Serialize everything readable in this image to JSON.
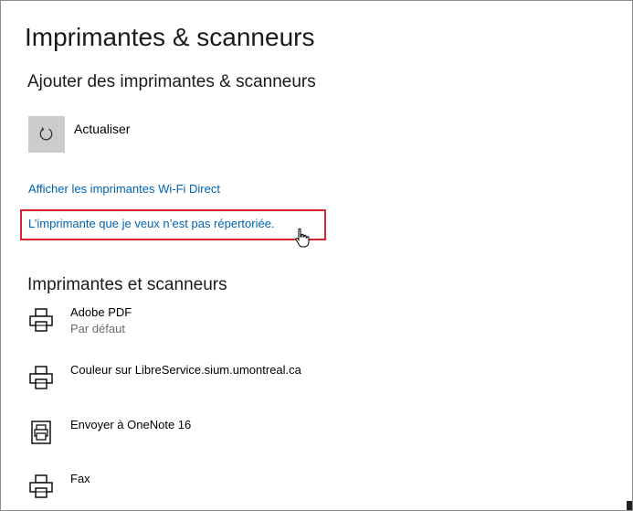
{
  "page": {
    "title": "Imprimantes & scanneurs"
  },
  "add_section": {
    "title": "Ajouter des imprimantes & scanneurs",
    "refresh_label": "Actualiser",
    "refresh_icon": "refresh-icon",
    "wifi_direct_link": "Afficher les imprimantes Wi-Fi Direct",
    "not_listed_link": "L’imprimante que je veux n’est pas répertoriée."
  },
  "list_section": {
    "title": "Imprimantes et scanneurs",
    "items": [
      {
        "name": "Adobe PDF",
        "status": "Par défaut",
        "icon": "printer-icon"
      },
      {
        "name": "Couleur sur LibreService.sium.umontreal.ca",
        "status": "",
        "icon": "printer-icon"
      },
      {
        "name": "Envoyer à OneNote 16",
        "status": "",
        "icon": "onenote-printer-icon"
      },
      {
        "name": "Fax",
        "status": "",
        "icon": "printer-icon"
      }
    ]
  },
  "colors": {
    "link": "#0063b1",
    "highlight": "#d9262b",
    "refresh_button_bg": "#cccccc"
  }
}
